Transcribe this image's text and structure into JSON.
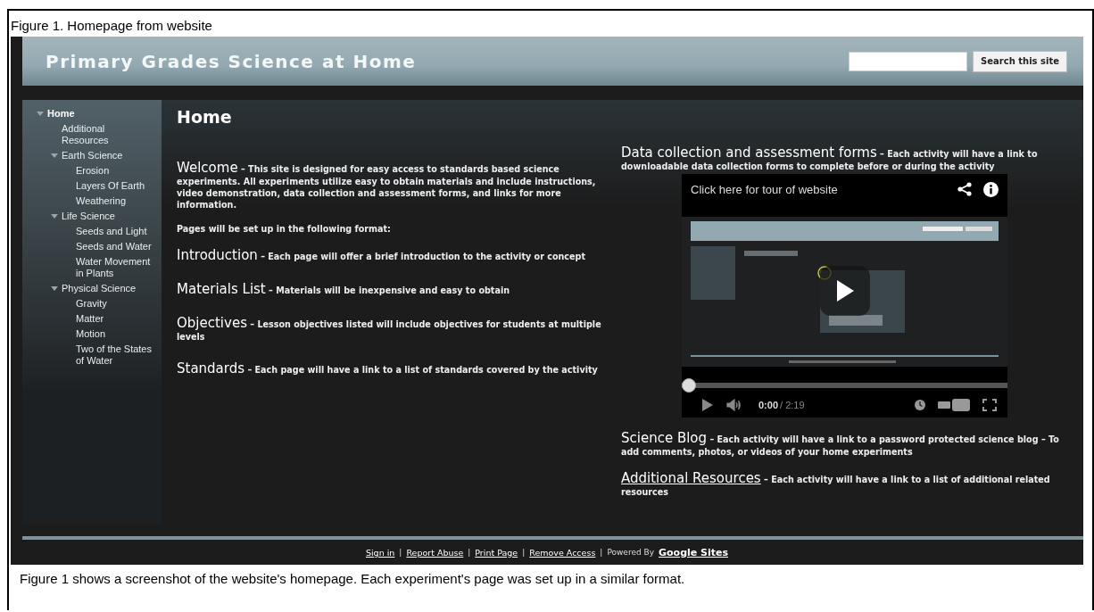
{
  "figure_caption": "Figure 1. Homepage from website",
  "site": {
    "title": "Primary Grades Science at Home",
    "search_button": "Search this site"
  },
  "nav": [
    {
      "label": "Home",
      "selected": true,
      "expanded": true,
      "children": [
        {
          "label": "Additional Resources",
          "selected": false
        },
        {
          "label": "Earth Science",
          "selected": false,
          "expanded": true,
          "children": [
            {
              "label": "Erosion",
              "selected": false
            },
            {
              "label": "Layers Of Earth",
              "selected": false
            },
            {
              "label": "Weathering",
              "selected": false
            }
          ]
        },
        {
          "label": "Life Science",
          "selected": false,
          "expanded": true,
          "children": [
            {
              "label": "Seeds and Light",
              "selected": false
            },
            {
              "label": "Seeds and Water",
              "selected": false
            },
            {
              "label": "Water Movement in Plants",
              "selected": false
            }
          ]
        },
        {
          "label": "Physical Science",
          "selected": false,
          "expanded": true,
          "children": [
            {
              "label": "Gravity",
              "selected": false
            },
            {
              "label": "Matter",
              "selected": false
            },
            {
              "label": "Motion",
              "selected": false
            },
            {
              "label": "Two of the States of Water",
              "selected": false
            }
          ]
        }
      ]
    }
  ],
  "page_heading": "Home",
  "left_column": [
    {
      "kind": "section",
      "heading": "Welcome",
      "text": "– This site is designed for easy access to standards based science experiments.  All experiments utilize easy to obtain materials and include instructions, video demonstration, data collection and assessment forms, and links for more information."
    },
    {
      "kind": "paragraph",
      "text": "Pages will be set up in the following format:"
    },
    {
      "kind": "section",
      "heading": "Introduction",
      "text": "– Each page will offer a brief introduction to the activity or concept"
    },
    {
      "kind": "section",
      "heading": "Materials List",
      "text": "– Materials will be inexpensive and easy to obtain"
    },
    {
      "kind": "section",
      "heading": "Objectives",
      "text": "– Lesson objectives listed will include objectives for students at multiple levels"
    },
    {
      "kind": "section",
      "heading": "Standards",
      "text": "– Each page will have a link to a list of standards covered by the activity"
    }
  ],
  "right_column": [
    {
      "kind": "section",
      "heading": "Data collection and assessment forms",
      "text": "– Each activity will have a link to downloadable data collection forms to complete before or during the activity"
    },
    {
      "kind": "video",
      "title": "Click here for tour of website",
      "time": "0:00",
      "duration": "/ 2:19",
      "level": 0
    },
    {
      "kind": "section",
      "heading": "Science Blog",
      "text": "– Each activity will have a link to a password protected science blog – To add comments, photos, or videos of your home experiments"
    },
    {
      "kind": "link_section",
      "heading": "Additional Resources",
      "text": "– Each activity will have a link to a list of additional related resources"
    }
  ],
  "footer": {
    "separator": "|",
    "items": [
      {
        "kind": "link",
        "label": "Sign in"
      },
      {
        "kind": "link",
        "label": "Report Abuse"
      },
      {
        "kind": "link",
        "label": "Print Page"
      },
      {
        "kind": "link",
        "label": "Remove Access"
      },
      {
        "kind": "text",
        "label": "Powered By"
      },
      {
        "kind": "brand",
        "label": "Google Sites"
      }
    ]
  },
  "bottom_caption": "Figure 1 shows a screenshot of the website's homepage.  Each experiment's page was set up in a similar format."
}
